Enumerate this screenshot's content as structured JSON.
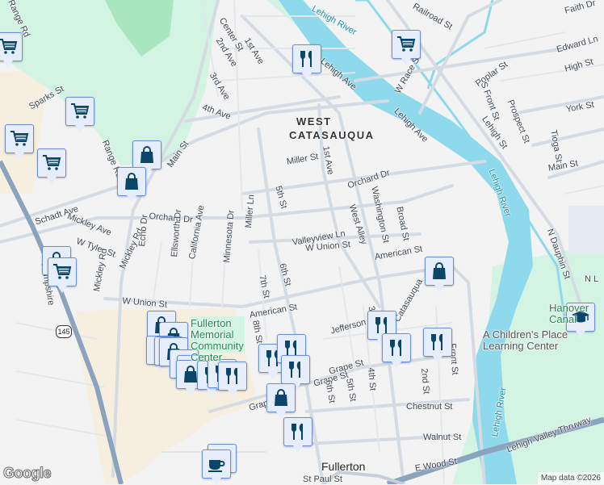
{
  "map": {
    "attribution": "Map data ©2026",
    "logo": "Google",
    "route_shield": "145",
    "colors": {
      "background": "#f4f3f4",
      "park": "#d3f4e2",
      "water": "#8ed9ec",
      "road": "#d4dbe2",
      "highway": "#8ca3bd",
      "commercial": "#f6efe0",
      "marker_fill": "#e6eefc",
      "marker_icon": "#0b4668"
    },
    "labels": [
      "1st Ave",
      "Center St",
      "2nd Ave",
      "3rd Ave",
      "4th Ave",
      "Range Rd",
      "Range Rd",
      "Sparks St",
      "Main St",
      "Schadt Ave",
      "Mickley Ave",
      "Orchard Dr",
      "Mickley Rd",
      "Echo Dr",
      "Ellsworth Dr",
      "California Ave",
      "Minnesota Dr",
      "Miller Ln",
      "Miller St",
      "5th St",
      "WEST",
      "CATASAUQUA",
      "1st Ave",
      "Orchard Dr",
      "Valleyview Ln",
      "W Union St",
      "Washington St",
      "West Alley",
      "Broad St",
      "American St",
      "W Tyler St",
      "W Union St",
      "7th St",
      "6th St",
      "American St",
      "8th St",
      "Jefferson St",
      "Catasauqua",
      "3rd St",
      "Grape St",
      "Grape St",
      "Grape St",
      "6th St",
      "5th St",
      "4th St",
      "2nd St",
      "Front St",
      "Chestnut St",
      "Walnut St",
      "E Wood St",
      "St Paul St",
      "Fullerton",
      "Lehigh River",
      "Lehigh Ave",
      "W Race St",
      "Railroad St",
      "Lehigh Ave",
      "Lehigh St",
      "Poplar St",
      "S Front St",
      "Prospect St",
      "Tioga St",
      "Main St",
      "York St",
      "High St",
      "Edward Ln",
      "Faith Dr",
      "Lehigh River",
      "N Dauphin St",
      "Lehigh River",
      "Lehigh Valley Thruway",
      "Mickley Rd",
      "Hampshire",
      "N L"
    ],
    "pois": [
      {
        "name": "Fullerton Memorial Community Center"
      },
      {
        "name": "A Children's Place Learning Center"
      },
      {
        "name": "Hanover Canal"
      }
    ],
    "markers": [
      "shopping-cart",
      "restaurant",
      "shopping-cart",
      "shopping-cart",
      "shopping-cart",
      "shopping-cart",
      "shopping-bag",
      "shopping-bag",
      "shopping-bag",
      "shopping-cart",
      "shopping-bag",
      "school",
      "shopping-bag",
      "shopping-bag",
      "shopping-bag",
      "shopping-bag",
      "shopping-bag",
      "shopping-bag",
      "shopping-bag",
      "shopping-bag",
      "restaurant",
      "restaurant",
      "restaurant",
      "restaurant",
      "restaurant",
      "restaurant",
      "restaurant",
      "restaurant",
      "restaurant",
      "shopping-bag",
      "restaurant",
      "cafe",
      "cafe"
    ]
  }
}
